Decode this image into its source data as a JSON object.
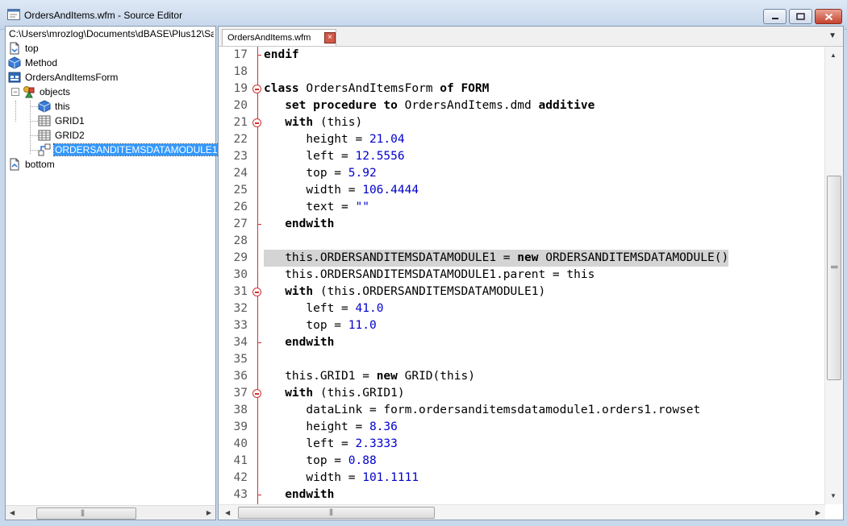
{
  "window": {
    "title": "OrdersAndItems.wfm - Source Editor",
    "buttons": [
      "minimize",
      "maximize",
      "close"
    ]
  },
  "outline": {
    "path": "C:\\Users\\mrozlog\\Documents\\dBASE\\Plus12\\Sa",
    "items": [
      {
        "label": "top",
        "icon": "page-icon"
      },
      {
        "label": "Method",
        "icon": "cube-icon"
      },
      {
        "label": "OrdersAndItemsForm",
        "icon": "form-icon"
      },
      {
        "label": "objects",
        "icon": "objects-icon"
      },
      {
        "label": "this",
        "icon": "cube-icon"
      },
      {
        "label": "GRID1",
        "icon": "grid-icon"
      },
      {
        "label": "GRID2",
        "icon": "grid-icon"
      },
      {
        "label": "ORDERSANDITEMSDATAMODULE1",
        "icon": "datamodule-icon",
        "selected": true
      },
      {
        "label": "bottom",
        "icon": "page-icon"
      }
    ]
  },
  "editor": {
    "tab_label": "OrdersAndItems.wfm",
    "lines": [
      {
        "n": "17",
        "fold": "end",
        "parts": [
          [
            "kw",
            "endif"
          ]
        ]
      },
      {
        "n": "18",
        "parts": []
      },
      {
        "n": "19",
        "fold": "start",
        "parts": [
          [
            "kw",
            "class"
          ],
          [
            "t",
            " OrdersAndItemsForm "
          ],
          [
            "kw",
            "of FORM"
          ]
        ]
      },
      {
        "n": "20",
        "parts": [
          [
            "t",
            "   "
          ],
          [
            "kw",
            "set procedure to"
          ],
          [
            "t",
            " OrdersAndItems.dmd "
          ],
          [
            "kw",
            "additive"
          ]
        ]
      },
      {
        "n": "21",
        "fold": "start",
        "parts": [
          [
            "t",
            "   "
          ],
          [
            "kw",
            "with"
          ],
          [
            "t",
            " (this)"
          ]
        ]
      },
      {
        "n": "22",
        "parts": [
          [
            "t",
            "      height = "
          ],
          [
            "num",
            "21.04"
          ]
        ]
      },
      {
        "n": "23",
        "parts": [
          [
            "t",
            "      left = "
          ],
          [
            "num",
            "12.5556"
          ]
        ]
      },
      {
        "n": "24",
        "parts": [
          [
            "t",
            "      top = "
          ],
          [
            "num",
            "5.92"
          ]
        ]
      },
      {
        "n": "25",
        "parts": [
          [
            "t",
            "      width = "
          ],
          [
            "num",
            "106.4444"
          ]
        ]
      },
      {
        "n": "26",
        "parts": [
          [
            "t",
            "      text = "
          ],
          [
            "num",
            "\"\""
          ]
        ]
      },
      {
        "n": "27",
        "fold": "end",
        "parts": [
          [
            "t",
            "   "
          ],
          [
            "kw",
            "endwith"
          ]
        ]
      },
      {
        "n": "28",
        "parts": []
      },
      {
        "n": "29",
        "highlight": true,
        "parts": [
          [
            "t",
            "   this.ORDERSANDITEMSDATAMODULE1 = "
          ],
          [
            "kw",
            "new"
          ],
          [
            "t",
            " ORDERSANDITEMSDATAMODULE()"
          ]
        ]
      },
      {
        "n": "30",
        "parts": [
          [
            "t",
            "   this.ORDERSANDITEMSDATAMODULE1.parent = this"
          ]
        ]
      },
      {
        "n": "31",
        "fold": "start",
        "parts": [
          [
            "t",
            "   "
          ],
          [
            "kw",
            "with"
          ],
          [
            "t",
            " (this.ORDERSANDITEMSDATAMODULE1)"
          ]
        ]
      },
      {
        "n": "32",
        "parts": [
          [
            "t",
            "      left = "
          ],
          [
            "num",
            "41.0"
          ]
        ]
      },
      {
        "n": "33",
        "parts": [
          [
            "t",
            "      top = "
          ],
          [
            "num",
            "11.0"
          ]
        ]
      },
      {
        "n": "34",
        "fold": "end",
        "parts": [
          [
            "t",
            "   "
          ],
          [
            "kw",
            "endwith"
          ]
        ]
      },
      {
        "n": "35",
        "parts": []
      },
      {
        "n": "36",
        "parts": [
          [
            "t",
            "   this.GRID1 = "
          ],
          [
            "kw",
            "new"
          ],
          [
            "t",
            " GRID(this)"
          ]
        ]
      },
      {
        "n": "37",
        "fold": "start",
        "parts": [
          [
            "t",
            "   "
          ],
          [
            "kw",
            "with"
          ],
          [
            "t",
            " (this.GRID1)"
          ]
        ]
      },
      {
        "n": "38",
        "parts": [
          [
            "t",
            "      dataLink = form.ordersanditemsdatamodule1.orders1.rowset"
          ]
        ]
      },
      {
        "n": "39",
        "parts": [
          [
            "t",
            "      height = "
          ],
          [
            "num",
            "8.36"
          ]
        ]
      },
      {
        "n": "40",
        "parts": [
          [
            "t",
            "      left = "
          ],
          [
            "num",
            "2.3333"
          ]
        ]
      },
      {
        "n": "41",
        "parts": [
          [
            "t",
            "      top = "
          ],
          [
            "num",
            "0.88"
          ]
        ]
      },
      {
        "n": "42",
        "parts": [
          [
            "t",
            "      width = "
          ],
          [
            "num",
            "101.1111"
          ]
        ]
      },
      {
        "n": "43",
        "fold": "end",
        "parts": [
          [
            "t",
            "   "
          ],
          [
            "kw",
            "endwith"
          ]
        ]
      }
    ]
  },
  "colors": {
    "keyword": "#000000",
    "number": "#0000cc",
    "fold_marker": "#cc3333",
    "selection": "#3399ff",
    "line_highlight": "#d4d4d4"
  }
}
